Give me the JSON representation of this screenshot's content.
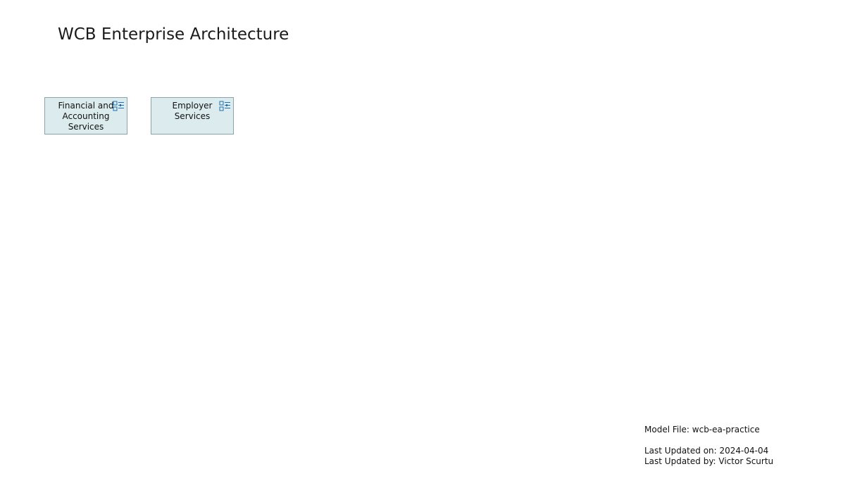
{
  "diagram": {
    "title": "WCB Enterprise Architecture",
    "elements": [
      {
        "label": "Financial and Accounting Services",
        "icon": "business-service-component-icon"
      },
      {
        "label": "Employer Services",
        "icon": "business-service-component-icon"
      }
    ]
  },
  "footer": {
    "model_file": "Model File: wcb-ea-practice",
    "last_updated_on": "Last Updated on: 2024-04-04",
    "last_updated_by": "Last Updated by: Victor Scurtu"
  },
  "colors": {
    "element_fill": "#dcebed",
    "element_border": "#8aa3a8",
    "icon_stroke": "#1f6fb2"
  }
}
